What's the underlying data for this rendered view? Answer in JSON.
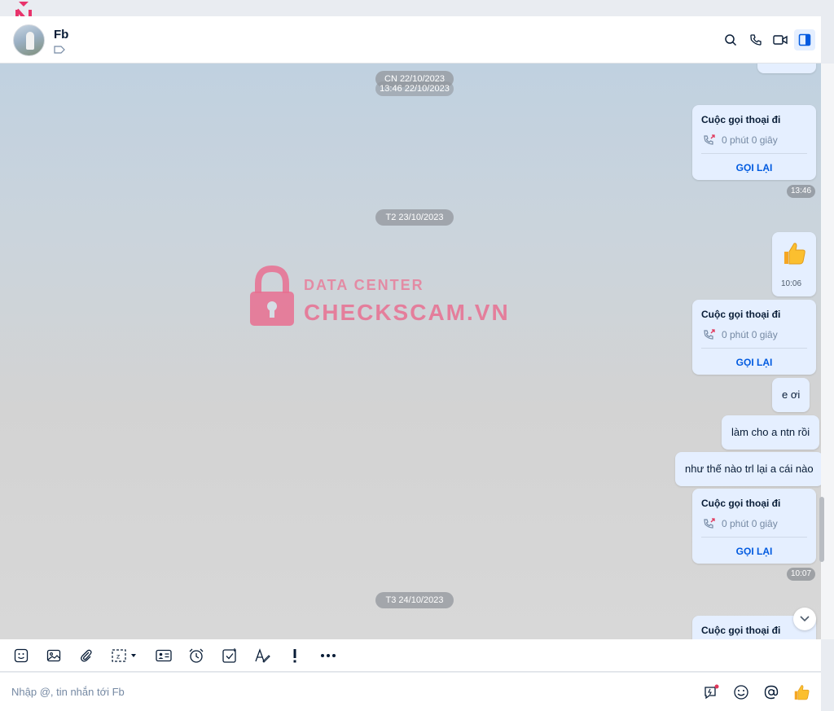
{
  "header": {
    "contact_name": "Fb"
  },
  "chat": {
    "dates": {
      "d1": "CN 22/10/2023",
      "d1_sub": "13:46 22/10/2023",
      "d2": "T2 23/10/2023",
      "d3": "T3 24/10/2023"
    },
    "call": {
      "title": "Cuộc gọi thoại đi",
      "duration": "0 phút 0 giây",
      "callback": "GỌI LẠI"
    },
    "times": {
      "t1": "13:46",
      "t2": "10:06",
      "t3": "10:07"
    },
    "messages": {
      "m1": "e ơi",
      "m2": "làm cho a ntn rồi",
      "m3": "như thế nào trl lại a cái nào"
    }
  },
  "watermark": {
    "line1": "DATA CENTER",
    "line2": "CHECKSCAM.VN"
  },
  "composer": {
    "placeholder": "Nhập @, tin nhắn tới Fb"
  },
  "colors": {
    "accent": "#005ae0",
    "bubble": "#e5efff",
    "call_out": "#e0375a"
  }
}
